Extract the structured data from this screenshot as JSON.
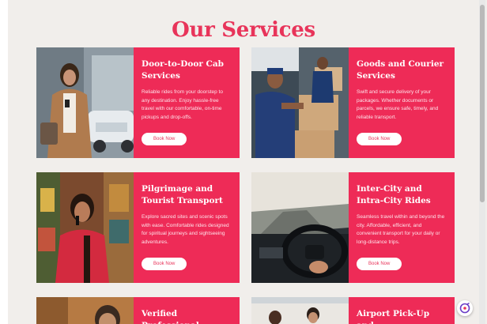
{
  "page": {
    "title": "Our Services"
  },
  "cards": [
    {
      "title": "Door-to-Door Cab Services",
      "text": "Reliable rides from your doorstep to any destination. Enjoy hassle-free travel with our comfortable, on-time pickups and drop-offs.",
      "button": "Book Now",
      "photo_icon": "woman-with-phone-photo"
    },
    {
      "title": "Goods and Courier Services",
      "text": "Swift and secure delivery of your packages. Whether documents or parcels, we ensure safe, timely, and reliable transport.",
      "button": "Book Now",
      "photo_icon": "courier-boxes-photo"
    },
    {
      "title": "Pilgrimage and Tourist Transport",
      "text": "Explore sacred sites and scenic spots with ease. Comfortable rides designed for spiritual journeys and sightseeing adventures.",
      "button": "Book Now",
      "photo_icon": "woman-at-temple-photo"
    },
    {
      "title": "Inter-City and Intra-City Rides",
      "text": "Seamless travel within and beyond the city. Affordable, efficient, and convenient transport for your daily or long-distance trips.",
      "button": "Book Now",
      "photo_icon": "car-interior-road-photo"
    },
    {
      "title": "Verified Professional",
      "photo_icon": "man-photo"
    },
    {
      "title": "Airport Pick-Up and",
      "photo_icon": "couple-airport-photo"
    }
  ],
  "fab": {
    "icon": "chat-widget-icon"
  },
  "colors": {
    "accent": "#ee2b57",
    "title": "#e8345a",
    "background": "#f1eeeb"
  }
}
